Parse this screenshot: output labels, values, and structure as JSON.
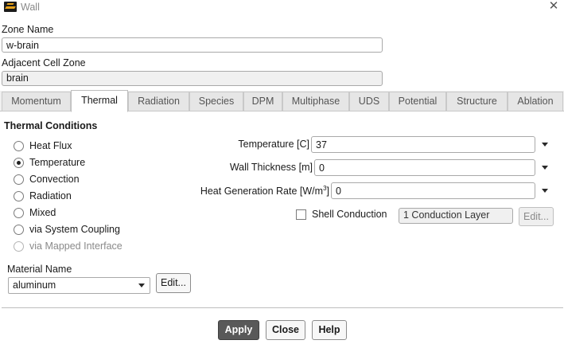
{
  "window": {
    "title": "Wall",
    "icon": "ansys-fluent-icon",
    "close_icon": "close-icon"
  },
  "form": {
    "zone_name_label": "Zone Name",
    "zone_name_value": "w-brain",
    "adjacent_label": "Adjacent Cell Zone",
    "adjacent_value": "brain"
  },
  "tabs": [
    "Momentum",
    "Thermal",
    "Radiation",
    "Species",
    "DPM",
    "Multiphase",
    "UDS",
    "Potential",
    "Structure",
    "Ablation"
  ],
  "active_tab": "Thermal",
  "thermal": {
    "section_title": "Thermal Conditions",
    "conditions": [
      "Heat Flux",
      "Temperature",
      "Convection",
      "Radiation",
      "Mixed",
      "via System Coupling",
      "via Mapped Interface"
    ],
    "selected_condition": "Temperature",
    "temperature_label": "Temperature [C]",
    "temperature_value": "37",
    "wall_thickness_label": "Wall Thickness [m]",
    "wall_thickness_value": "0",
    "heat_gen_label_prefix": "Heat Generation Rate [W/m",
    "heat_gen_label_sup": "3",
    "heat_gen_label_suffix": "]",
    "heat_gen_value": "0",
    "shell_conduction_label": "Shell Conduction",
    "shell_conduction_checked": false,
    "conduction_layers_value": "1 Conduction Layer",
    "layers_edit_label": "Edit...",
    "material_label": "Material Name",
    "material_value": "aluminum",
    "material_edit_label": "Edit..."
  },
  "buttons": {
    "apply": "Apply",
    "close": "Close",
    "help": "Help"
  },
  "colors": {
    "primary_button": "#595959",
    "background": "#f0f0f0",
    "panel": "#ffffff"
  }
}
